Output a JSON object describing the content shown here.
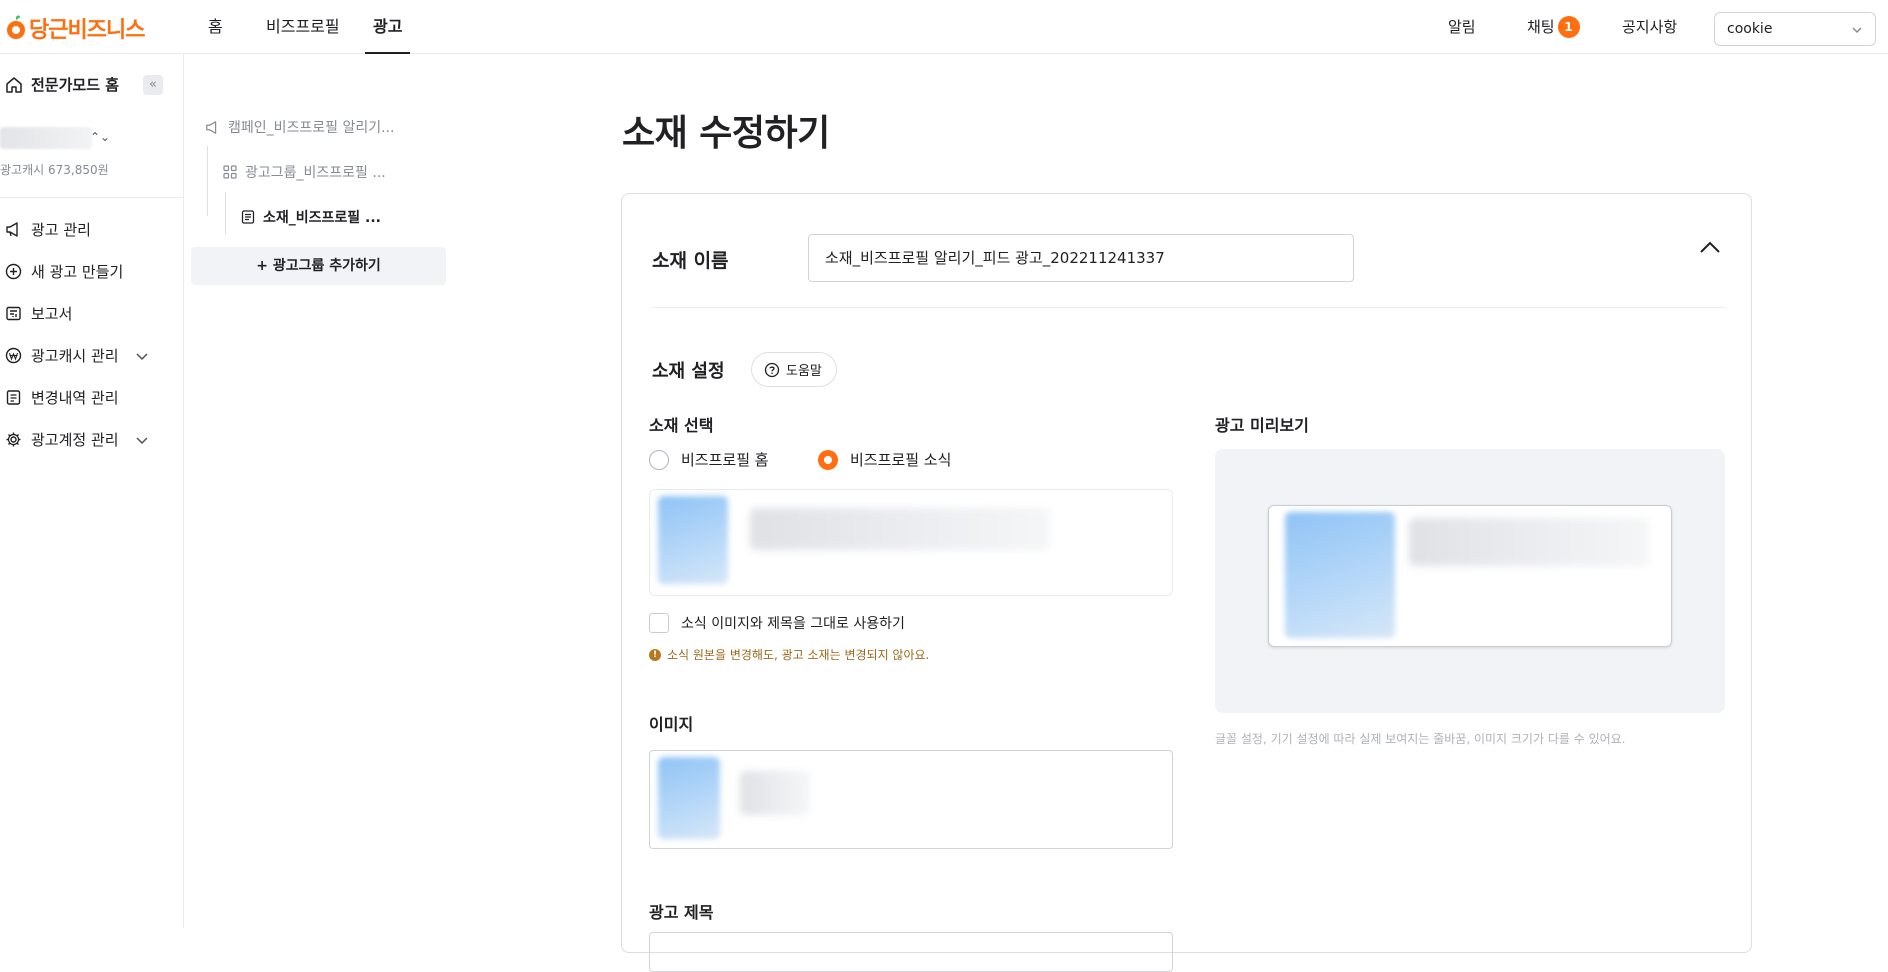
{
  "app": {
    "logo_text": "당근비즈니스",
    "nav_tabs": [
      {
        "label": "홈",
        "active": false
      },
      {
        "label": "비즈프로필",
        "active": false
      },
      {
        "label": "광고",
        "active": true
      }
    ],
    "notifications_label": "알림",
    "chat_label": "채팅",
    "chat_badge": "1",
    "notice_label": "공지사항",
    "account_select_value": "cookie",
    "accent_color": "#ff6f0f"
  },
  "sidebar": {
    "home_label": "전문가모드 홈",
    "collapse_glyph": "«",
    "account_arrows": "⌃⌄",
    "ad_cash_text": "광고캐시 673,850원",
    "items": [
      {
        "label": "광고 관리",
        "icon": "megaphone-icon",
        "has_chevron": false
      },
      {
        "label": "새 광고 만들기",
        "icon": "plus-circle-icon",
        "has_chevron": false
      },
      {
        "label": "보고서",
        "icon": "report-icon",
        "has_chevron": false
      },
      {
        "label": "광고캐시 관리",
        "icon": "won-coin-icon",
        "has_chevron": true
      },
      {
        "label": "변경내역 관리",
        "icon": "document-list-icon",
        "has_chevron": false
      },
      {
        "label": "광고계정 관리",
        "icon": "gear-icon",
        "has_chevron": true
      }
    ]
  },
  "tree": {
    "campaign": "캠페인_비즈프로필 알리기...",
    "ad_group": "광고그룹_비즈프로필 ...",
    "creative": "소재_비즈프로필 ...",
    "add_group_button": "+ 광고그룹 추가하기"
  },
  "main": {
    "page_title": "소재 수정하기",
    "name_label": "소재 이름",
    "name_value": "소재_비즈프로필 알리기_피드 광고_202211241337",
    "settings_label": "소재 설정",
    "help_button": "도움말",
    "select_label": "소재 선택",
    "radio_options": [
      {
        "label": "비즈프로필 홈",
        "checked": false
      },
      {
        "label": "비즈프로필 소식",
        "checked": true
      }
    ],
    "use_as_is_label": "소식 이미지와 제목을 그대로 사용하기",
    "use_as_is_checked": false,
    "warning_text": "소식 원본을 변경해도, 광고 소재는 변경되지 않아요.",
    "image_label": "이미지",
    "ad_title_label": "광고 제목",
    "preview_label": "광고 미리보기",
    "preview_note": "글꼴 설정, 기기 설정에 따라 실제 보여지는 줄바꿈, 이미지 크기가 다를 수 있어요."
  }
}
